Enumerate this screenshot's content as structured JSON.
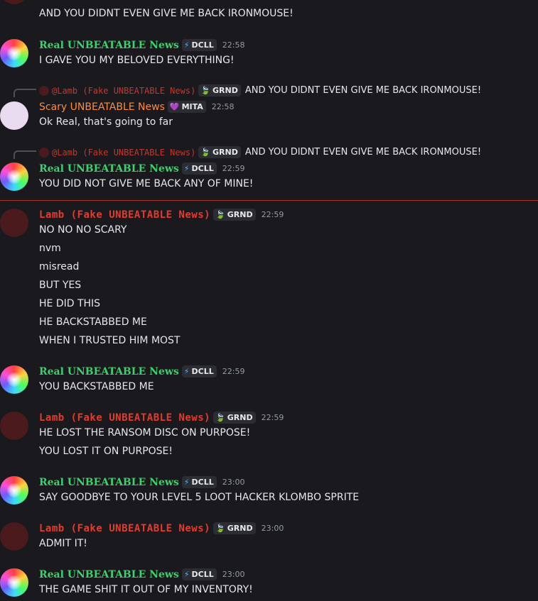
{
  "messages": {
    "m0": {
      "line1": "AND YOU DIDNT EVEN GIVE ME BACK IRONMOUSE!"
    },
    "m1": {
      "author": "Real UNBEATABLE News",
      "tag": "DCLL",
      "time": "22:58",
      "line1": "I GAVE YOU MY BELOVED EVERYTHING!"
    },
    "m2": {
      "reply_author": "@Lamb (Fake UNBEATABLE News)",
      "reply_tag": "GRND",
      "reply_text": "AND YOU DIDNT EVEN GIVE ME BACK IRONMOUSE!",
      "author": "Scary UNBEATABLE News",
      "tag": "MITA",
      "time": "22:58",
      "line1": "Ok Real, that's going to far"
    },
    "m3": {
      "reply_author": "@Lamb (Fake UNBEATABLE News)",
      "reply_tag": "GRND",
      "reply_text": "AND YOU DIDNT EVEN GIVE ME BACK IRONMOUSE!",
      "author": "Real UNBEATABLE News",
      "tag": "DCLL",
      "time": "22:59",
      "line1": "YOU DID NOT GIVE ME BACK ANY OF MINE!"
    },
    "m4": {
      "author": "Lamb (Fake UNBEATABLE News)",
      "tag": "GRND",
      "time": "22:59",
      "lines": [
        "NO NO NO SCARY",
        "nvm",
        "misread",
        "BUT YES",
        "HE DID THIS",
        "HE BACKSTABBED ME",
        "WHEN I TRUSTED HIM MOST"
      ]
    },
    "m5": {
      "author": "Real UNBEATABLE News",
      "tag": "DCLL",
      "time": "22:59",
      "line1": "YOU BACKSTABBED ME"
    },
    "m6": {
      "author": "Lamb (Fake UNBEATABLE News)",
      "tag": "GRND",
      "time": "22:59",
      "lines": [
        "HE LOST THE RANSOM DISC ON PURPOSE!",
        "YOU LOST IT ON PURPOSE!"
      ]
    },
    "m7": {
      "author": "Real UNBEATABLE News",
      "tag": "DCLL",
      "time": "23:00",
      "line1": "SAY GOODBYE TO YOUR LEVEL 5 LOOT HACKER KLOMBO SPRITE"
    },
    "m8": {
      "author": "Lamb (Fake UNBEATABLE News)",
      "tag": "GRND",
      "time": "23:00",
      "line1": "ADMIT IT!"
    },
    "m9": {
      "author": "Real UNBEATABLE News",
      "tag": "DCLL",
      "time": "23:00",
      "line1": "THE GAME SHIT IT OUT OF MY INVENTORY!"
    }
  },
  "icons": {
    "dcll": "lightning-bolt-icon",
    "grnd": "leaf-icon",
    "mita": "heart-icon"
  },
  "colors": {
    "real": "#3bd16f",
    "lamb": "#e33b2e",
    "scary": "#ff8a3a",
    "divider": "#a3342b",
    "background": "#1a1a1e"
  }
}
